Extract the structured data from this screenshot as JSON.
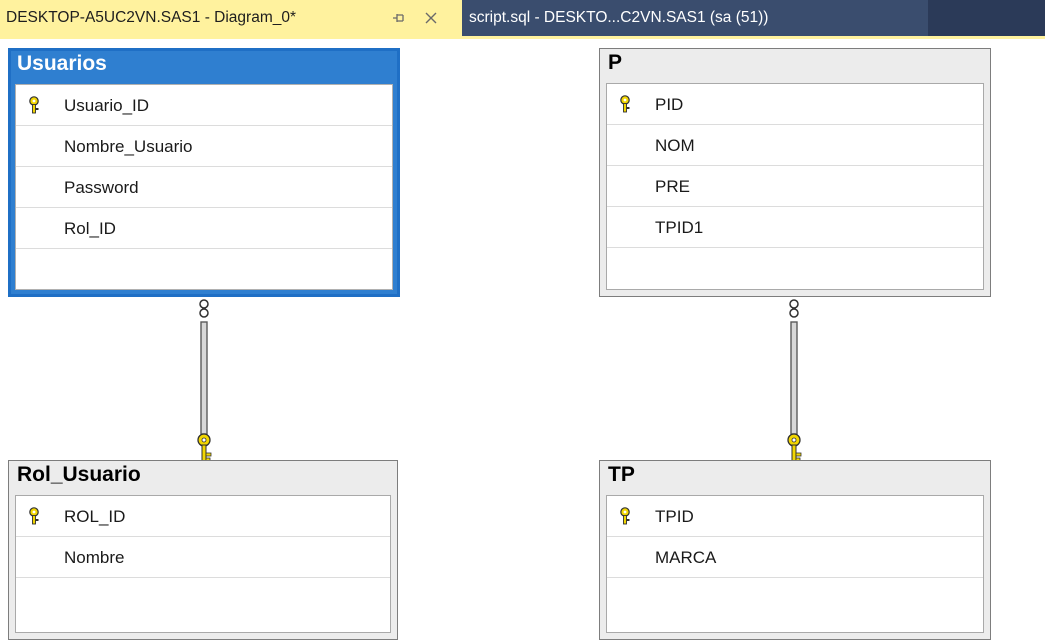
{
  "tabs": [
    {
      "label": "DESKTOP-A5UC2VN.SAS1 - Diagram_0*",
      "active": true
    },
    {
      "label": "script.sql - DESKTO...C2VN.SAS1 (sa (51))",
      "active": false
    }
  ],
  "tab_icons": {
    "pin": "pin-icon",
    "close": "close-icon"
  },
  "colors": {
    "active_tab": "#fff29e",
    "tab_strip": "#2b3a58",
    "selection": "#1f6fc5",
    "key_icon": "#f2d600"
  },
  "tables": {
    "usuarios": {
      "title": "Usuarios",
      "selected": true,
      "columns": [
        {
          "name": "Usuario_ID",
          "primary_key": true
        },
        {
          "name": "Nombre_Usuario",
          "primary_key": false
        },
        {
          "name": "Password",
          "primary_key": false
        },
        {
          "name": "Rol_ID",
          "primary_key": false
        }
      ]
    },
    "p": {
      "title": "P",
      "selected": false,
      "columns": [
        {
          "name": "PID",
          "primary_key": true
        },
        {
          "name": "NOM",
          "primary_key": false
        },
        {
          "name": "PRE",
          "primary_key": false
        },
        {
          "name": "TPID1",
          "primary_key": false
        }
      ]
    },
    "rol_usuario": {
      "title": "Rol_Usuario",
      "selected": false,
      "columns": [
        {
          "name": "ROL_ID",
          "primary_key": true
        },
        {
          "name": "Nombre",
          "primary_key": false
        }
      ]
    },
    "tp": {
      "title": "TP",
      "selected": false,
      "columns": [
        {
          "name": "TPID",
          "primary_key": true
        },
        {
          "name": "MARCA",
          "primary_key": false
        }
      ]
    }
  },
  "relationships": [
    {
      "from": "Usuarios",
      "to": "Rol_Usuario",
      "many_end": "infinity-icon",
      "one_end": "key-icon"
    },
    {
      "from": "P",
      "to": "TP",
      "many_end": "infinity-icon",
      "one_end": "key-icon"
    }
  ]
}
